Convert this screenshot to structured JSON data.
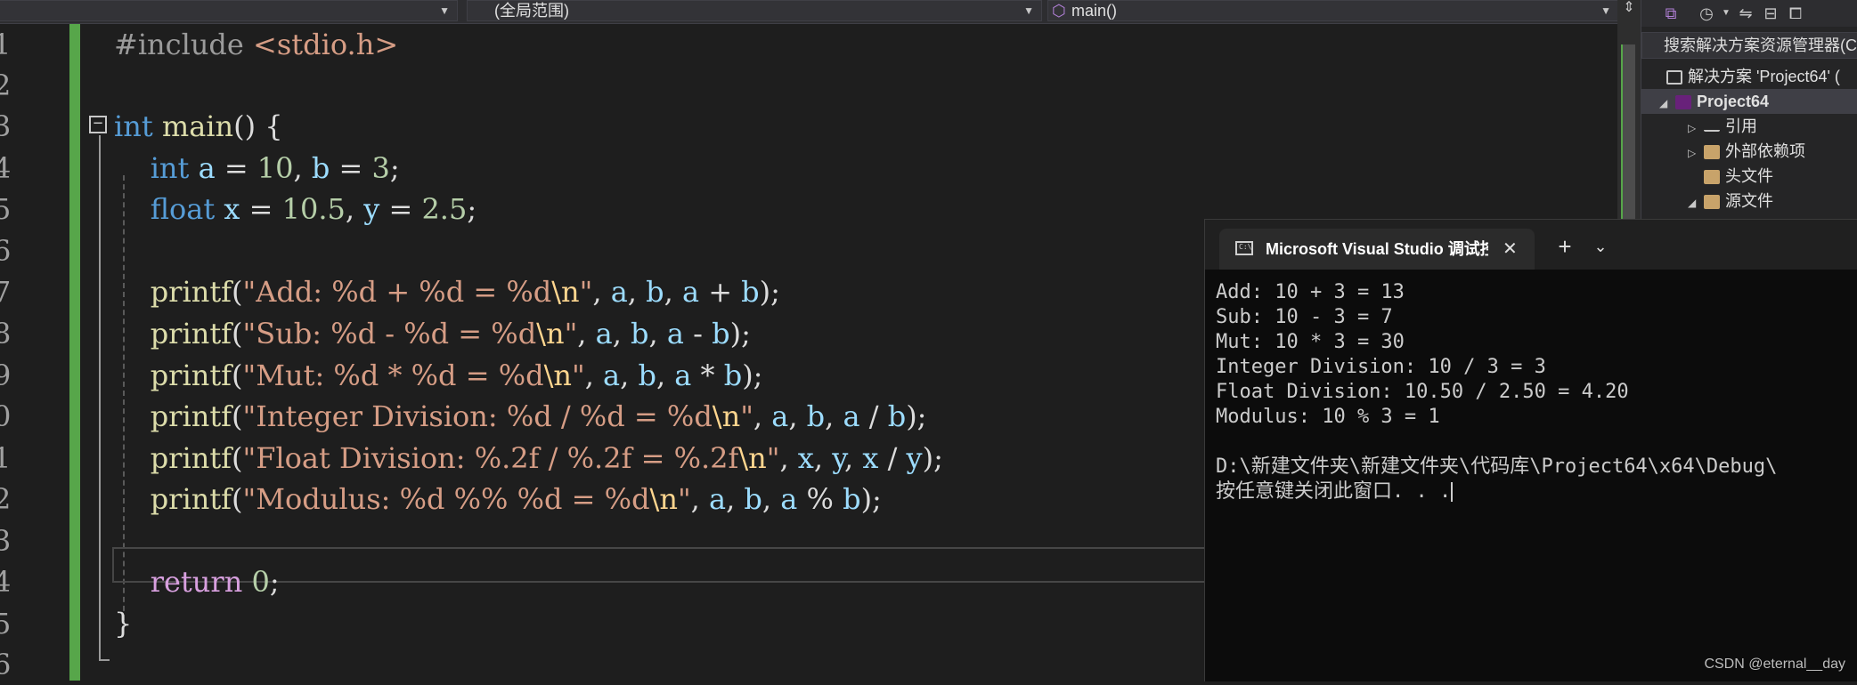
{
  "navbar": {
    "scope_dropdown": "(全局范围)",
    "function_dropdown": "main()"
  },
  "editor": {
    "line_numbers": [
      "1",
      "2",
      "3",
      "4",
      "5",
      "6",
      "7",
      "8",
      "9",
      "0",
      "1",
      "2",
      "3",
      "4",
      "5",
      "6"
    ],
    "fold_glyph": "−"
  },
  "solution_explorer": {
    "search_placeholder": "搜索解决方案资源管理器(C",
    "items": [
      {
        "label": "解决方案 'Project64' (",
        "arrow": ""
      },
      {
        "label": "Project64",
        "arrow": "◢"
      },
      {
        "label": "引用",
        "arrow": "▷"
      },
      {
        "label": "外部依赖项",
        "arrow": "▷"
      },
      {
        "label": "头文件",
        "arrow": ""
      },
      {
        "label": "源文件",
        "arrow": "◢"
      }
    ]
  },
  "console": {
    "tab_title": "Microsoft Visual Studio 调试控制台",
    "close_glyph": "✕",
    "new_tab_glyph": "+",
    "dropdown_glyph": "⌄",
    "lines": [
      "Add: 10 + 3 = 13",
      "Sub: 10 - 3 = 7",
      "Mut: 10 * 3 = 30",
      "Integer Division: 10 / 3 = 3",
      "Float Division: 10.50 / 2.50 = 4.20",
      "Modulus: 10 % 3 = 1",
      "",
      "D:\\新建文件夹\\新建文件夹\\代码库\\Project64\\x64\\Debug\\",
      "按任意键关闭此窗口. . ."
    ],
    "watermark": "CSDN @eternal__day"
  }
}
